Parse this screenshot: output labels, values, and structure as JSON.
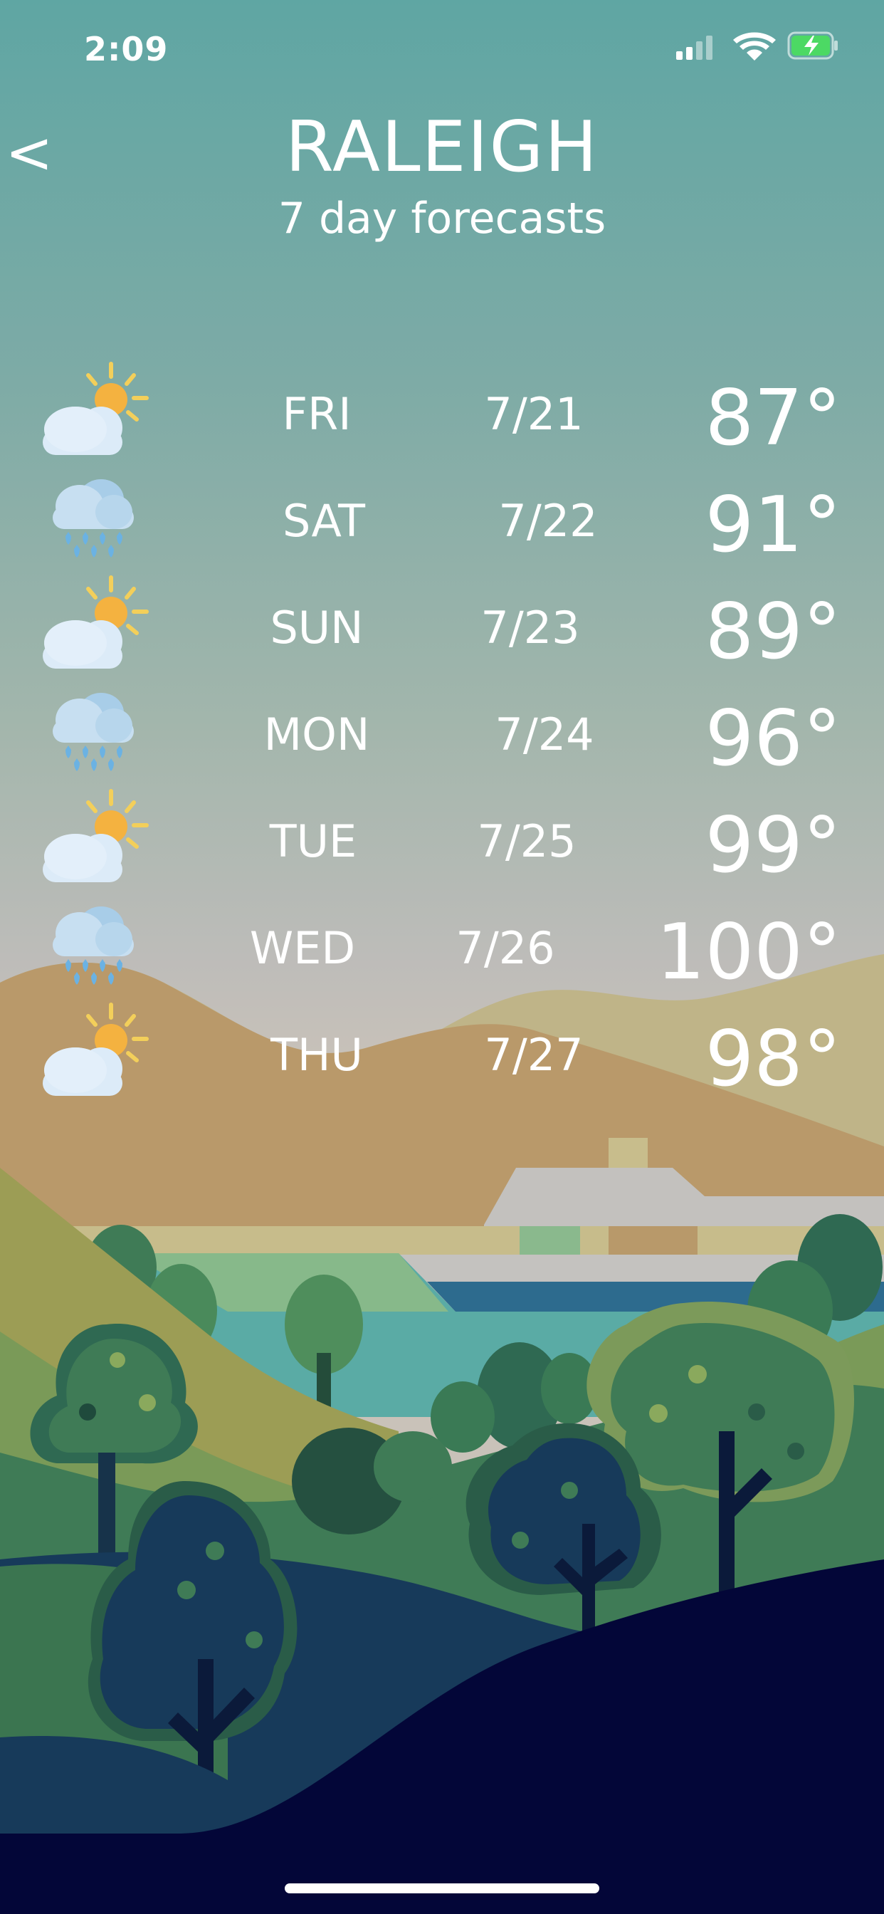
{
  "status_bar": {
    "time": "2:09"
  },
  "header": {
    "back_label": "<",
    "city": "RALEIGH",
    "subtitle": "7 day forecasts"
  },
  "forecast": [
    {
      "day": "FRI",
      "date": "7/21",
      "temp": "87°",
      "condition": "partly-sunny-icon"
    },
    {
      "day": "SAT",
      "date": "7/22",
      "temp": "91°",
      "condition": "rain-cloud-icon"
    },
    {
      "day": "SUN",
      "date": "7/23",
      "temp": "89°",
      "condition": "partly-sunny-icon"
    },
    {
      "day": "MON",
      "date": "7/24",
      "temp": "96°",
      "condition": "rain-cloud-icon"
    },
    {
      "day": "TUE",
      "date": "7/25",
      "temp": "99°",
      "condition": "partly-sunny-icon"
    },
    {
      "day": "WED",
      "date": "7/26",
      "temp": "100°",
      "condition": "rain-cloud-icon"
    },
    {
      "day": "THU",
      "date": "7/27",
      "temp": "98°",
      "condition": "partly-sunny-icon"
    }
  ],
  "colors": {
    "battery": "#4cd964",
    "text": "#ffffff",
    "sun": "#f4b240",
    "cloud": "#dcebf8",
    "rain": "#6bb2e3"
  }
}
